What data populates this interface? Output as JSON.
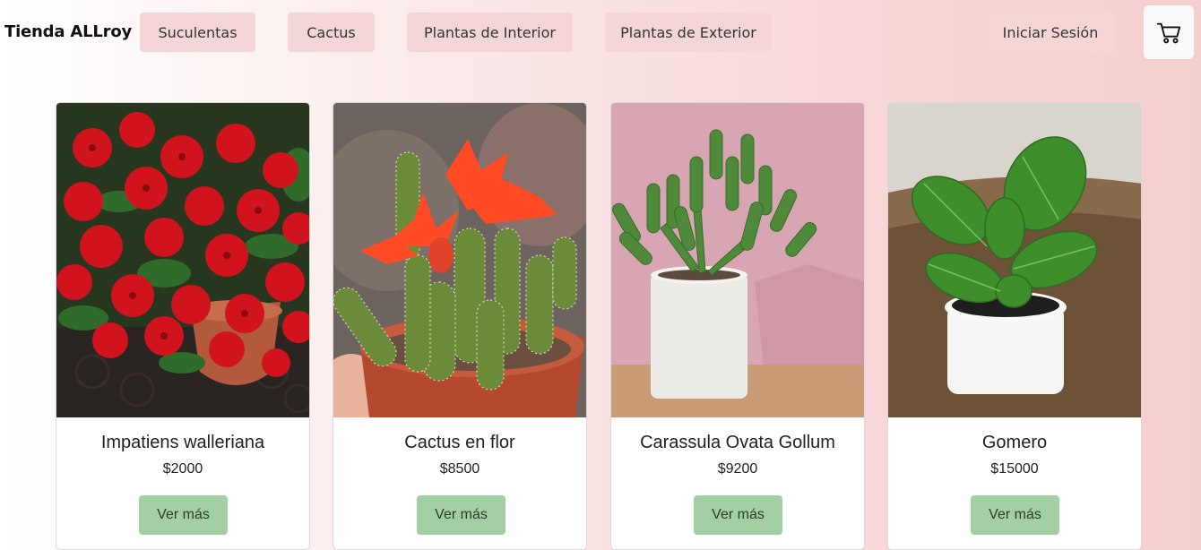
{
  "header": {
    "brand": "Tienda ALLroy",
    "nav": [
      "Suculentas",
      "Cactus",
      "Plantas de Interior",
      "Plantas de Exterior"
    ],
    "login_label": "Iniciar Sesión",
    "cart_icon": "cart-icon"
  },
  "products": [
    {
      "name": "Impatiens walleriana",
      "price": "$2000",
      "button": "Ver más",
      "image": "red-impatiens-flowers"
    },
    {
      "name": "Cactus en flor",
      "price": "$8500",
      "button": "Ver más",
      "image": "flowering-cactus"
    },
    {
      "name": "Carassula Ovata Gollum",
      "price": "$9200",
      "button": "Ver más",
      "image": "gollum-succulent"
    },
    {
      "name": "Gomero",
      "price": "$15000",
      "button": "Ver más",
      "image": "fiddle-leaf-plant"
    }
  ],
  "colors": {
    "nav_bg": "#f4d6d6",
    "button_green": "#a3cfa5",
    "cart_bg": "#f8f9fb"
  }
}
